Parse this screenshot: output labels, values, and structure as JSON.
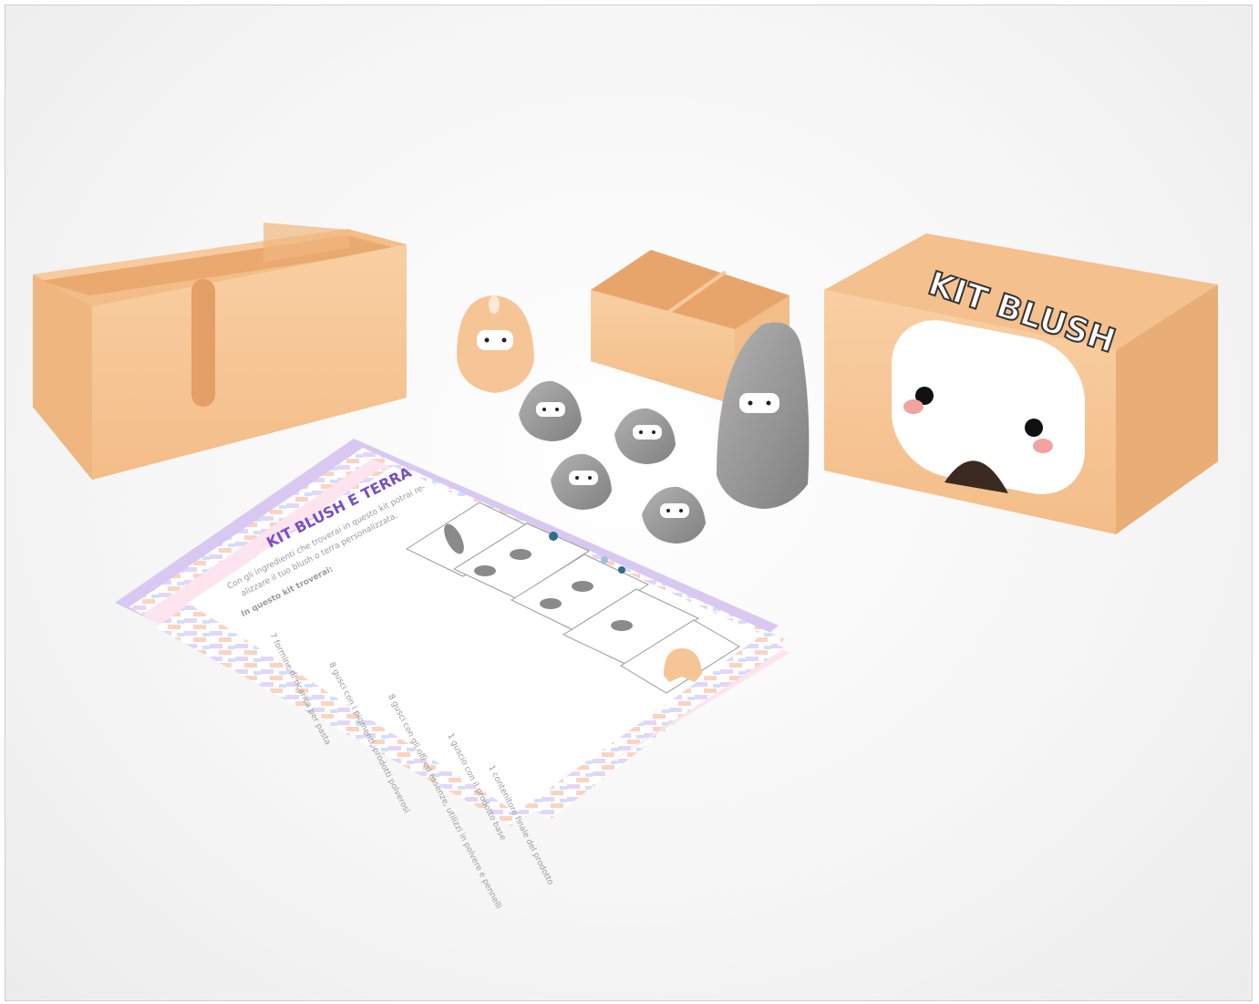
{
  "scene": {
    "box_title": "KIT BLUSH",
    "card_title": "KIT BLUSH E TERRA",
    "card_lines": [
      "Con gli ingredienti che troverai in questo kit potrai re-",
      "alizzare il tuo blush o terra personalizzata.",
      "In questo kit troverai:",
      "7 formine di ricarica per pasta",
      "8 gusci con i pigmenti, prodotti polverosi",
      "8 gusci con gli olii ed essenze, utilizzi in polvere e pennelli",
      "1 guscio con il prodotto base",
      "1 contenitore finale del prodotto"
    ],
    "colors": {
      "box": "#f8c899",
      "box_dark": "#e8ac76",
      "figure_grey": "#9a9a9a",
      "accent_pink": "#f0a3a0",
      "card_purple": "#d8c8f2"
    }
  }
}
